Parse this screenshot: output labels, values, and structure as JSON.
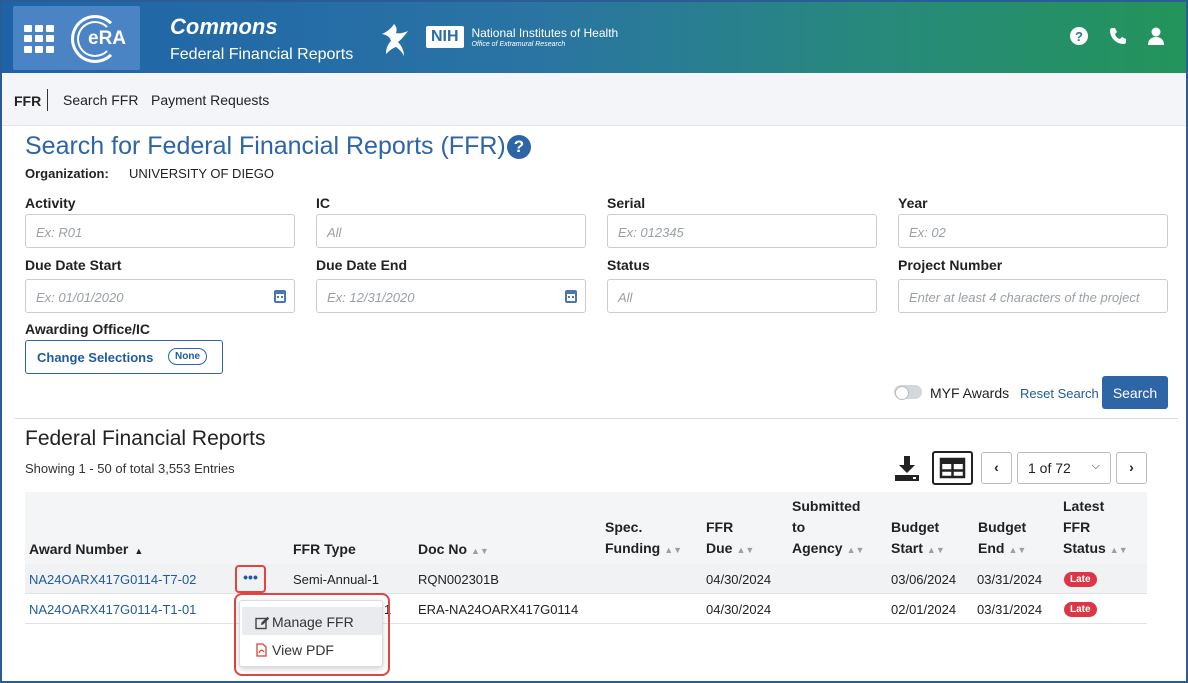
{
  "header": {
    "app_title": "Commons",
    "app_subtitle": "Federal Financial Reports",
    "era_logo_text": "eRA",
    "nih_badge": "NIH",
    "nih_name": "National Institutes of Health",
    "nih_office": "Office of Extramural Research"
  },
  "subnav": {
    "current": "FFR",
    "items": [
      "Search FFR",
      "Payment Requests"
    ]
  },
  "search": {
    "title": "Search for Federal Financial Reports (FFR)",
    "org_label": "Organization:",
    "org_value": "UNIVERSITY OF  DIEGO",
    "fields": {
      "activity": {
        "label": "Activity",
        "placeholder": "Ex: R01"
      },
      "ic": {
        "label": "IC",
        "placeholder": "All"
      },
      "serial": {
        "label": "Serial",
        "placeholder": "Ex: 012345"
      },
      "year": {
        "label": "Year",
        "placeholder": "Ex: 02"
      },
      "due_start": {
        "label": "Due Date Start",
        "placeholder": "Ex: 01/01/2020"
      },
      "due_end": {
        "label": "Due Date End",
        "placeholder": "Ex: 12/31/2020"
      },
      "status": {
        "label": "Status",
        "placeholder": "All"
      },
      "project_number": {
        "label": "Project Number",
        "placeholder": "Enter at least 4 characters of the project"
      }
    },
    "awarding_label": "Awarding Office/IC",
    "change_selections": "Change Selections",
    "none_pill": "None",
    "myf_label": "MYF Awards",
    "myf_on": false,
    "reset_label": "Reset Search",
    "search_label": "Search"
  },
  "results": {
    "title": "Federal Financial Reports",
    "showing": "Showing 1 - 50 of total 3,553 Entries",
    "pager": {
      "prev": "‹",
      "next": "›",
      "page_label": "1 of 72"
    },
    "columns": {
      "award_number": "Award Number",
      "ffr_type": "FFR Type",
      "doc_no": "Doc No",
      "spec_funding_1": "Spec.",
      "spec_funding_2": "Funding",
      "ffr_due_1": "FFR",
      "ffr_due_2": "Due",
      "submitted_1": "Submitted",
      "submitted_2": "to",
      "submitted_3": "Agency",
      "budget_start_1": "Budget",
      "budget_start_2": "Start",
      "budget_end_1": "Budget",
      "budget_end_2": "End",
      "status_1": "Latest",
      "status_2": "FFR",
      "status_3": "Status"
    },
    "rows": [
      {
        "award_number": "NA24OARX417G0114-T7-02",
        "ffr_type": "Semi-Annual-1",
        "doc_no": "RQN002301B",
        "spec_funding": "",
        "ffr_due": "04/30/2024",
        "submitted": "",
        "budget_start": "03/06/2024",
        "budget_end": "03/31/2024",
        "status": "Late"
      },
      {
        "award_number": "NA24OARX417G0114-T1-01",
        "ffr_type_partial": "1",
        "doc_no": "ERA-NA24OARX417G0114",
        "spec_funding": "",
        "ffr_due": "04/30/2024",
        "submitted": "",
        "budget_start": "02/01/2024",
        "budget_end": "03/31/2024",
        "status": "Late"
      }
    ],
    "actions_menu": {
      "trigger": "•••",
      "items": [
        "Manage FFR",
        "View PDF"
      ]
    }
  },
  "colors": {
    "brand_blue": "#2e65a6",
    "link_blue": "#1f5b9e",
    "late_red": "#dc3545",
    "highlight_red": "#e0453f",
    "header_green": "#23945a"
  }
}
